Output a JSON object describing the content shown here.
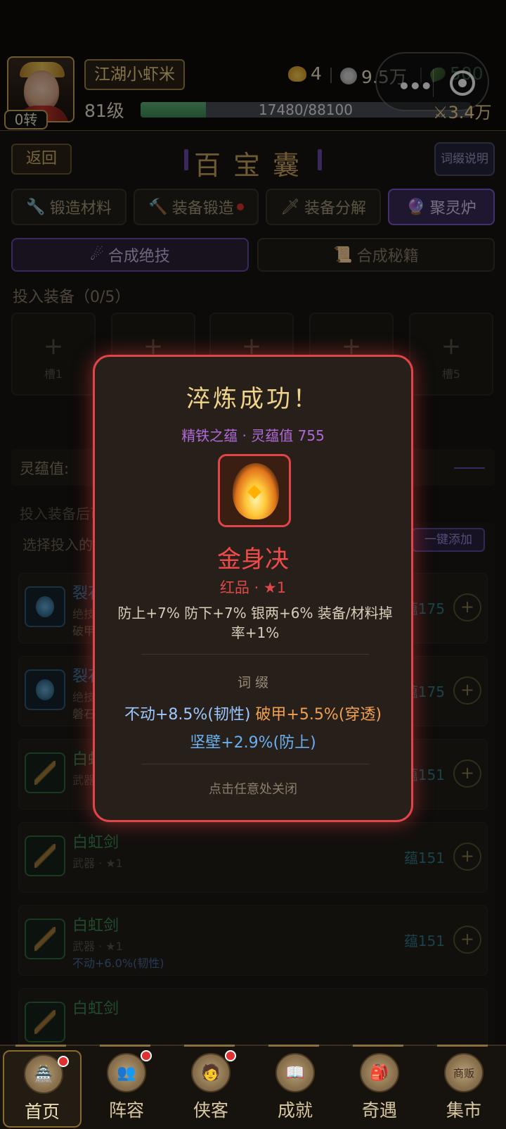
{
  "header": {
    "rebirth": "0转",
    "player_name": "江湖小虾米",
    "level": "81级",
    "exp_text": "17480/88100",
    "exp_fraction": 0.198,
    "gold_ingot": "4",
    "silver": "9.5万",
    "jade": "500",
    "power": "3.4万"
  },
  "page": {
    "back": "返回",
    "title": "百宝囊",
    "affix_help": "词缀说明",
    "tabs": [
      {
        "icon": "🔧",
        "label": "锻造材料"
      },
      {
        "icon": "🔨",
        "label": "装备锻造"
      },
      {
        "icon": "🗡",
        "label": "装备分解"
      },
      {
        "icon": "🔮",
        "label": "聚灵炉"
      }
    ],
    "subtabs": [
      {
        "icon": "☄",
        "label": "合成绝技"
      },
      {
        "icon": "📜",
        "label": "合成秘籍"
      }
    ],
    "input_label": "投入装备（0/5）",
    "slots": [
      {
        "plus": "+",
        "label": "槽1"
      },
      {
        "plus": "+",
        "label": "槽2"
      },
      {
        "plus": "+",
        "label": "槽3"
      },
      {
        "plus": "+",
        "label": "槽4"
      },
      {
        "plus": "+",
        "label": "槽5"
      }
    ],
    "value_label": "灵蕴值:",
    "hint": "投入装备后可萃炼灵蕴",
    "select_label": "选择投入的装备",
    "add_all": "一键添加",
    "items": [
      {
        "name": "裂石拳",
        "sub": "绝技 · ★1",
        "affix": "破甲+7.0%(穿透)",
        "yun": "蕴175"
      },
      {
        "name": "裂石拳",
        "sub": "绝技 · ★1",
        "affix": "磐石+2.0%(防下)",
        "yun": "蕴175"
      },
      {
        "name": "白虹剑",
        "sub": "武器 · ★1",
        "affix": "",
        "yun": "蕴151"
      },
      {
        "name": "白虹剑",
        "sub": "武器 · ★1",
        "affix": "",
        "yun": "蕴151"
      },
      {
        "name": "白虹剑",
        "sub": "武器 · ★1",
        "affix": "不动+6.0%(韧性)",
        "yun": "蕴151"
      },
      {
        "name": "白虹剑",
        "sub": "",
        "affix": "",
        "yun": ""
      }
    ]
  },
  "modal": {
    "title": "淬炼成功！",
    "source": "精铁之蕴 · 灵蕴值 755",
    "skill_name": "金身决",
    "grade": "红品 · ★1",
    "stats": "防上+7% 防下+7% 银两+6% 装备/材料掉率+1%",
    "affix_head": "词 缀",
    "affix_line1": [
      {
        "text": "不动+8.5%(韧性)",
        "color": "#9ec8ff"
      },
      {
        "text": "破甲+5.5%(穿透)",
        "color": "#f0a050"
      }
    ],
    "affix_line2": [
      {
        "text": "坚壁+2.9%(防上)",
        "color": "#6ab0f0"
      }
    ],
    "close_hint": "点击任意处关闭"
  },
  "nav": [
    {
      "label": "首页",
      "icon": "🏯",
      "badge": true,
      "active": true
    },
    {
      "label": "阵容",
      "icon": "👥",
      "badge": true,
      "active": false
    },
    {
      "label": "侠客",
      "icon": "🧑",
      "badge": true,
      "active": false
    },
    {
      "label": "成就",
      "icon": "📖",
      "badge": false,
      "active": false
    },
    {
      "label": "奇遇",
      "icon": "🎒",
      "badge": false,
      "active": false
    },
    {
      "label": "集市",
      "icon": "商贩",
      "badge": false,
      "active": false
    }
  ]
}
